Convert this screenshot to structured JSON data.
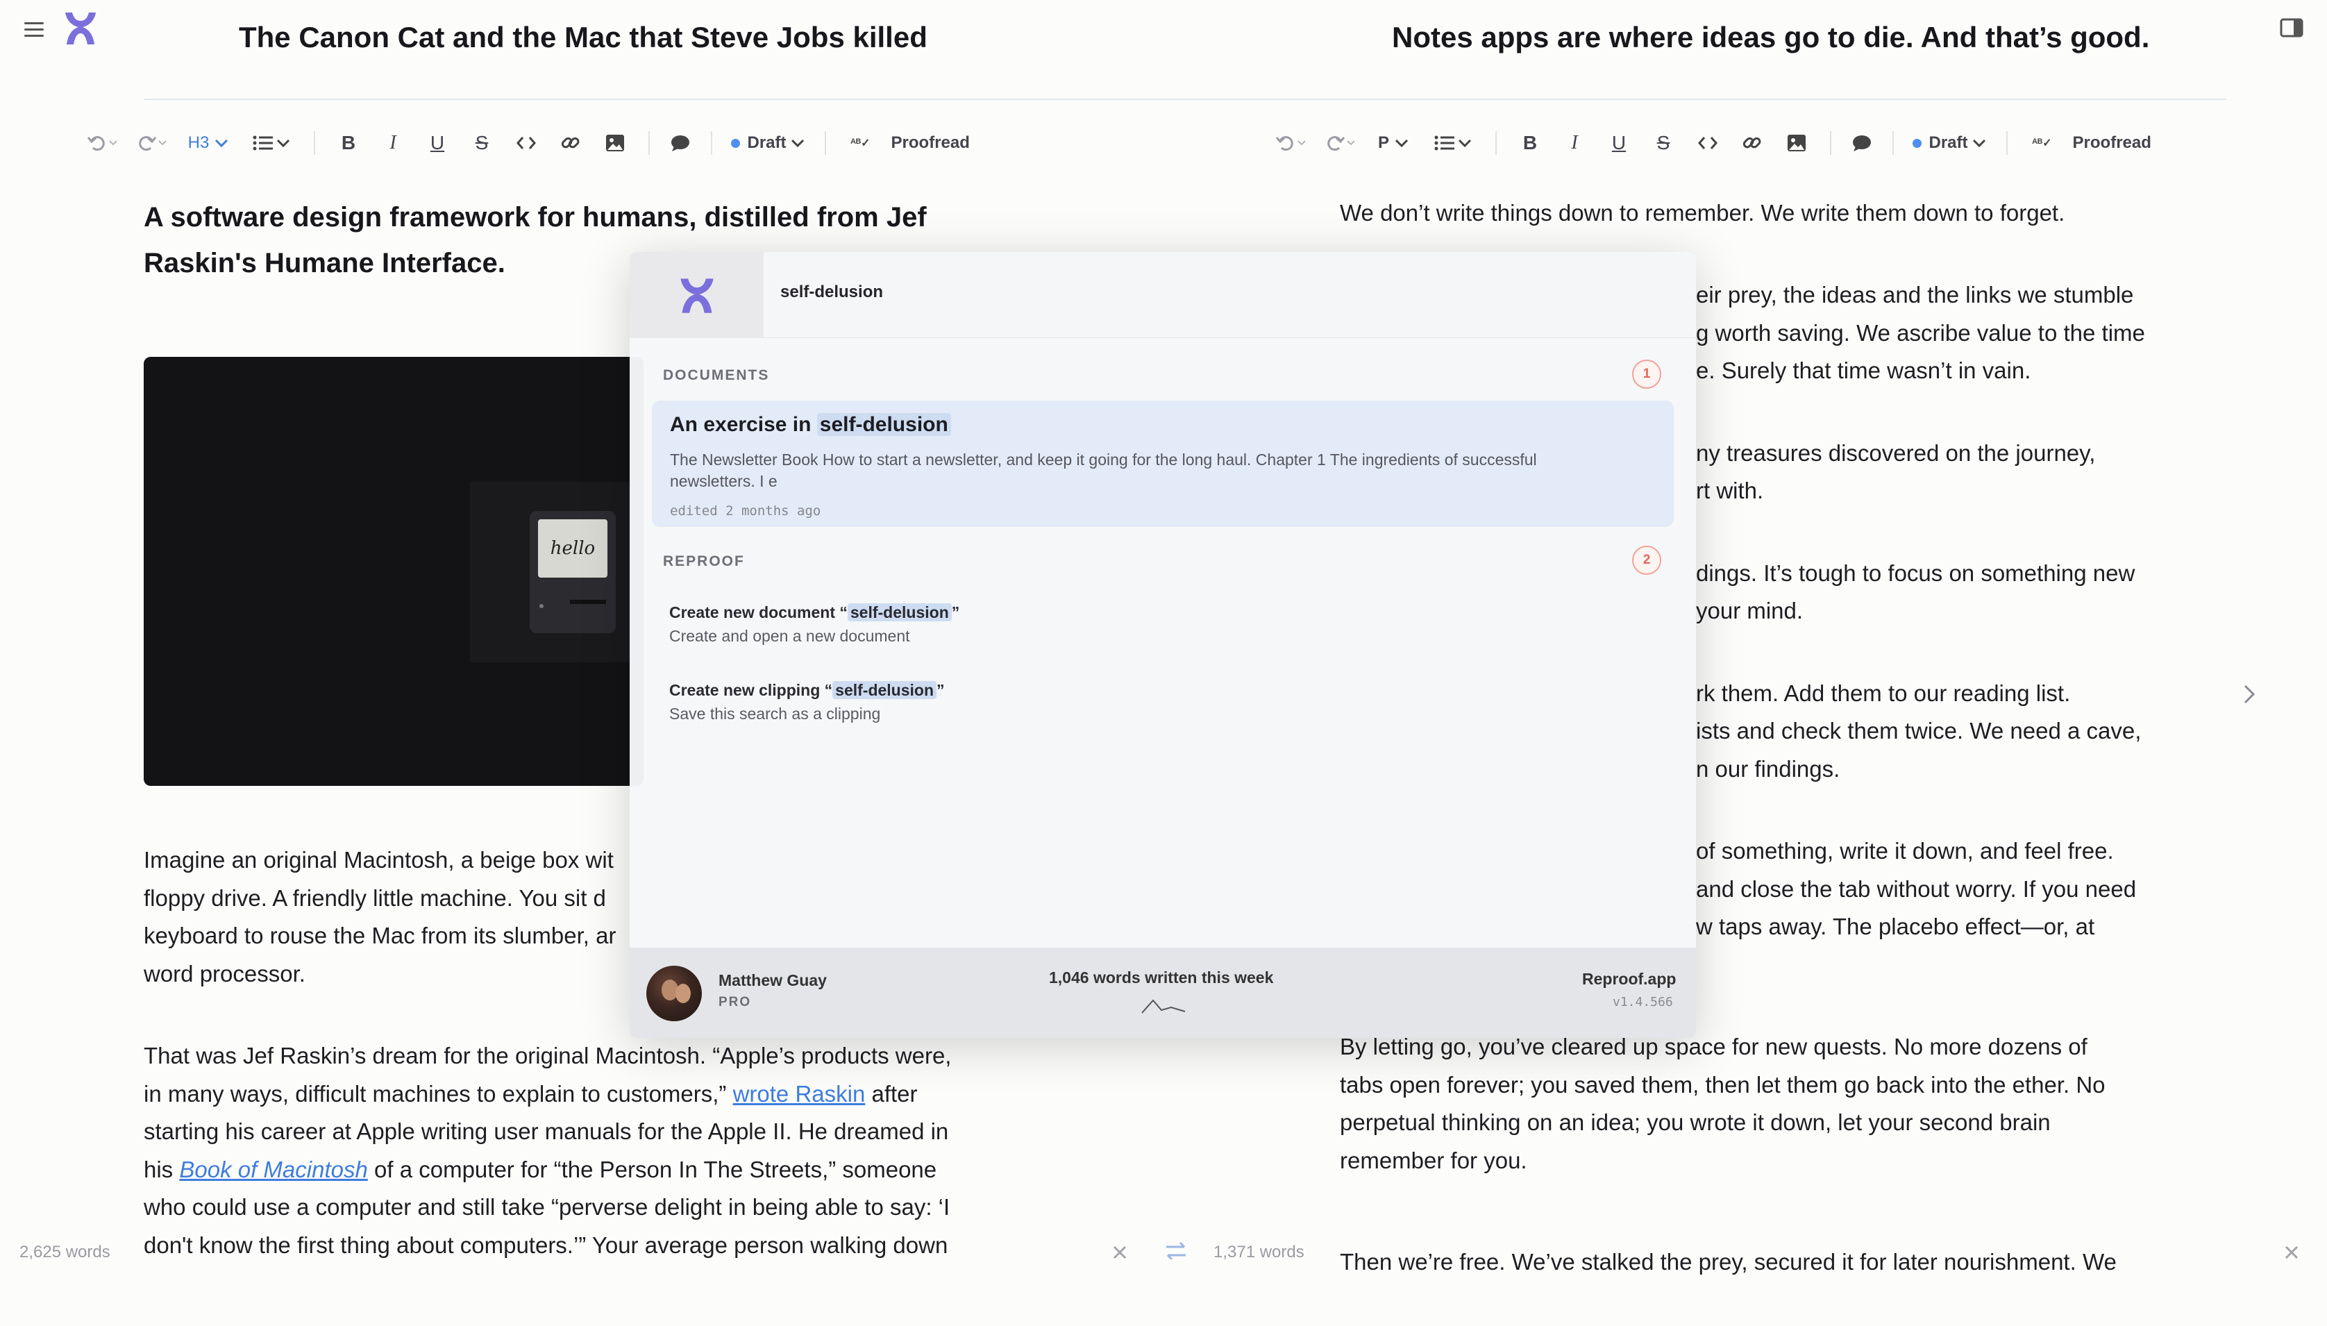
{
  "left_doc": {
    "title": "The Canon Cat and the Mac that Steve Jobs killed",
    "toolbar": {
      "block_type": "H3",
      "status": "Draft",
      "proofread": "Proofread"
    },
    "subheading_line1": "A software design framework for humans, distilled from Jef",
    "subheading_line2": "Raskin's Humane Interface.",
    "image_text": "hello",
    "p1": {
      "l1": "Imagine an original Macintosh, a beige box wit",
      "l2": "floppy drive. A friendly little machine. You sit d",
      "l3": "keyboard to rouse the Mac from its slumber, ar",
      "l4": "word processor."
    },
    "p2": {
      "l1": "That was Jef Raskin’s dream for the original Macintosh. “Apple’s products were,",
      "l2_a": "in many ways, difficult machines to explain to customers,”",
      "l2_link": "wrote Raskin",
      "l2_b": "after",
      "l3": "starting his career at Apple writing user manuals for the Apple II. He dreamed in",
      "l4_a": "his",
      "l4_link": "Book of Macintosh",
      "l4_b": "of a computer for “the Person In The Streets,” someone",
      "l5": "who could use a computer and still take “perverse delight in being able to say: ‘I",
      "l6": "don't know the first thing about computers.’” Your average person walking down"
    },
    "word_count": "2,625 words"
  },
  "right_doc": {
    "title": "Notes apps are where ideas go to die. And that’s good.",
    "toolbar": {
      "block_type": "P",
      "status": "Draft",
      "proofread": "Proofread"
    },
    "p1": "We don’t write things down to remember. We write them down to forget.",
    "p2": {
      "l1": "eir prey, the ideas and the links we stumble",
      "l2": "g worth saving. We ascribe value to the time",
      "l3": "e. Surely that time wasn’t in vain."
    },
    "p3": {
      "l1": "ny treasures discovered on the journey,",
      "l2": "rt with."
    },
    "p4": {
      "l1": "dings. It’s tough to focus on something new",
      "l2": "your mind."
    },
    "p5": {
      "l1": "rk them. Add them to our reading list.",
      "l2": "ists and check them twice. We need a cave,",
      "l3": "n our findings."
    },
    "p6": {
      "l1": "of something, write it down, and feel free.",
      "l2": "and close the tab without worry. If you need",
      "l3": "w taps away. The placebo effect—or, at"
    },
    "p7": {
      "l1": "By letting go, you’ve cleared up space for new quests. No more dozens of",
      "l2": "tabs open forever; you saved them, then let them go back into the ether. No",
      "l3": "perpetual thinking on an idea; you wrote it down, let your second brain",
      "l4": "remember for you."
    },
    "p8": "Then we’re free. We’ve stalked the prey, secured it for later nourishment. We",
    "word_count": "1,371 words"
  },
  "search_popup": {
    "query": "self-delusion",
    "documents_label": "DOCUMENTS",
    "documents_count": "1",
    "result": {
      "title_prefix": "An exercise in",
      "title_highlight": "self-delusion",
      "snippet": "The Newsletter Book How to start a newsletter, and keep it going for the long haul. Chapter 1 The ingredients of successful newsletters. I e",
      "meta": "edited 2 months ago"
    },
    "reproof_label": "REPROOF",
    "reproof_count": "2",
    "actions": [
      {
        "title_prefix": "Create new document “",
        "highlight": "self-delusion",
        "title_suffix": "”",
        "subtitle": "Create and open a new document"
      },
      {
        "title_prefix": "Create new clipping “",
        "highlight": "self-delusion",
        "title_suffix": "”",
        "subtitle": "Save this search as a clipping"
      }
    ],
    "footer": {
      "user_name": "Matthew Guay",
      "plan": "PRO",
      "stats": "1,046 words written this week",
      "app_name": "Reproof.app",
      "version": "v1.4.566"
    }
  },
  "colors": {
    "accent": "#7b6fdc",
    "link": "#3f7ddd",
    "status_dot": "#4d8ef0",
    "badge": "#e2675a"
  }
}
